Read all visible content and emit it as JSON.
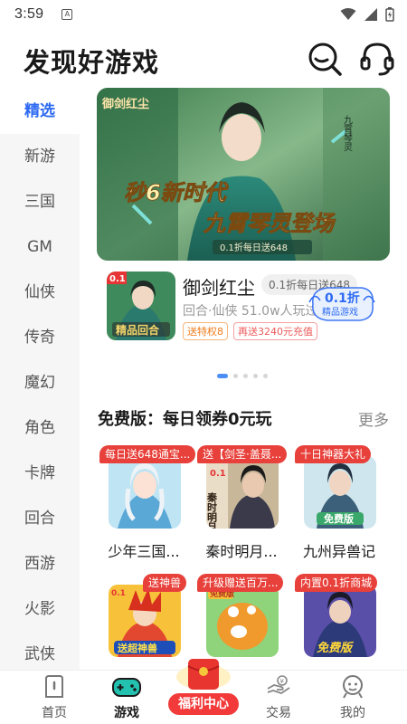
{
  "status_bar": {
    "time": "3:59",
    "notif_glyph": "A"
  },
  "header": {
    "title": "发现好游戏",
    "search_icon": "search-icon",
    "service_icon": "headset-icon"
  },
  "sidebar": {
    "items": [
      {
        "label": "精选",
        "active": true
      },
      {
        "label": "新游"
      },
      {
        "label": "三国"
      },
      {
        "label": "GM"
      },
      {
        "label": "仙侠"
      },
      {
        "label": "传奇"
      },
      {
        "label": "魔幻"
      },
      {
        "label": "角色"
      },
      {
        "label": "卡牌"
      },
      {
        "label": "回合"
      },
      {
        "label": "西游"
      },
      {
        "label": "火影"
      },
      {
        "label": "武侠"
      }
    ]
  },
  "banner": {
    "headline1": "秒6新时代",
    "headline2": "九霄琴灵登场",
    "strap": "0.1折每日送648",
    "logo": "御剑红尘",
    "vertical_text": "九霄琴灵"
  },
  "featured_game": {
    "name": "御剑红尘",
    "discount_pill": "0.1折每日送648",
    "meta": "回合·仙侠  51.0w人玩过",
    "tags": [
      "送特权8",
      "再送3240元充值"
    ],
    "badge_main": "0.1折",
    "badge_sub": "精品游戏",
    "thumb_corner": "0.1",
    "thumb_caption": "精品回合"
  },
  "carousel": {
    "count": 5,
    "active_index": 0
  },
  "section": {
    "title": "免费版：每日领券0元玩",
    "more": "更多"
  },
  "games_grid": [
    {
      "ribbon": "每日送648通宝...",
      "name": "少年三国...",
      "img_text": ""
    },
    {
      "ribbon": "送【剑圣·盖聂...",
      "name": "秦时明月...",
      "img_text": "秦时明月"
    },
    {
      "ribbon": "十日神器大礼",
      "name": "九州异兽记",
      "img_text": "免费版"
    },
    {
      "ribbon": "送神兽",
      "name": "",
      "img_text": "送超神兽"
    },
    {
      "ribbon": "升级赠送百万...",
      "name": "",
      "img_text": "免费版"
    },
    {
      "ribbon": "内置0.1折商城",
      "name": "",
      "img_text": "免费版"
    }
  ],
  "tabbar": {
    "tabs": [
      {
        "label": "首页",
        "icon": "home-icon"
      },
      {
        "label": "游戏",
        "icon": "gamepad-icon",
        "active": true
      },
      {
        "label": "福利中心",
        "icon": "red-envelope-icon"
      },
      {
        "label": "交易",
        "icon": "trade-icon"
      },
      {
        "label": "我的",
        "icon": "profile-icon"
      }
    ]
  },
  "colors": {
    "accent": "#2f6bf2",
    "ribbon_red": "#e8403a",
    "sidebar_bg": "#f6f6f6"
  }
}
